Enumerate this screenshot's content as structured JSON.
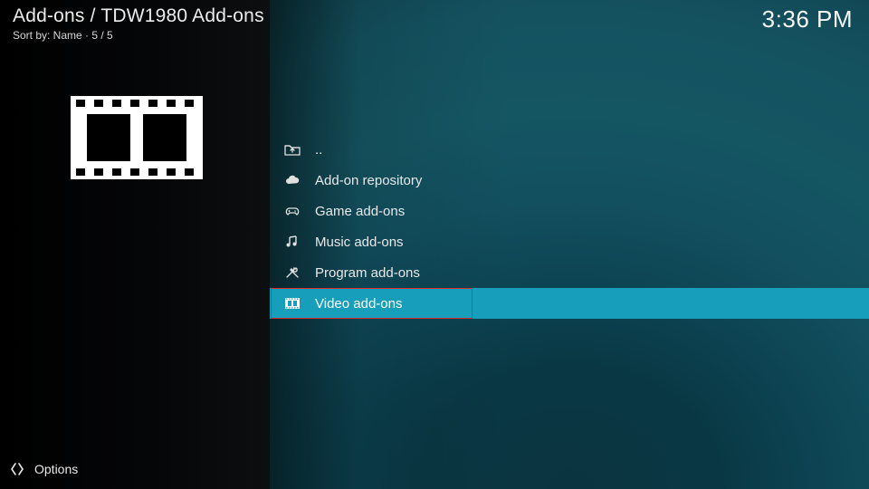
{
  "header": {
    "breadcrumb": "Add-ons / TDW1980 Add-ons",
    "sort_line": "Sort by: Name  ·  5 / 5",
    "clock": "3:36 PM"
  },
  "list": {
    "items": [
      {
        "icon": "folder-up-icon",
        "label": ".."
      },
      {
        "icon": "cloud-icon",
        "label": "Add-on repository"
      },
      {
        "icon": "gamepad-icon",
        "label": "Game add-ons"
      },
      {
        "icon": "music-icon",
        "label": "Music add-ons"
      },
      {
        "icon": "tools-icon",
        "label": "Program add-ons"
      },
      {
        "icon": "film-icon",
        "label": "Video add-ons"
      }
    ],
    "selected_index": 5
  },
  "footer": {
    "options_label": "Options"
  },
  "colors": {
    "selection": "#179eba",
    "annotation": "#d62e2e"
  }
}
